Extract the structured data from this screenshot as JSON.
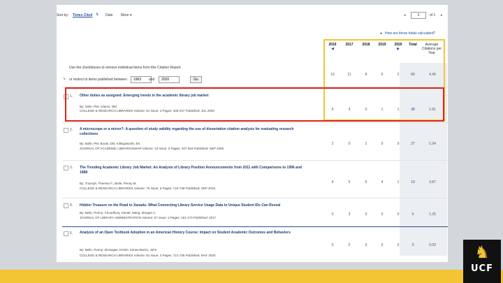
{
  "sort": {
    "label": "Sort by:",
    "active": "Times Cited",
    "options": [
      "Date",
      "More"
    ],
    "page_current": "1",
    "page_total": "of 1"
  },
  "help_link": "How are these totals calculated?",
  "years": [
    "2016",
    "2017",
    "2018",
    "2019",
    "2020",
    "Total",
    "Average Citations per Year"
  ],
  "hint": "Use the checkboxes to remove individual items from this Citation Report",
  "restrict": {
    "label": "or restrict to items published between",
    "from": "1963",
    "and": "and",
    "to": "2020",
    "go": "Go"
  },
  "totals": [
    "19",
    "11",
    "8",
    "5",
    "2",
    "89",
    "4.45"
  ],
  "records": [
    {
      "num": "1.",
      "title": "Other duties as assigned: Emerging trends in the academic library job market",
      "authors": "By: Seile, PM; Adams, NM",
      "source": "COLLEGE & RESEARCH LIBRARIES  Volume: 61  Issue: 4  Pages: 336-347  Published: JUL 2000",
      "cites": [
        "4",
        "4",
        "0",
        "1",
        "1",
        "38",
        "1.81"
      ]
    },
    {
      "num": "2.",
      "title": "A microscope or a mirror?: A question of study validity regarding the use of dissertation citation analysis for evaluating research collections",
      "authors": "By: Bolle, PM; Boote, DN; Killingsworth, EK",
      "source": "JOURNAL OF ACADEMIC LIBRARIANSHIP  Volume: 34  Issue: 5  Pages: 347-353  Published: SEP 2008",
      "cites": [
        "2",
        "0",
        "1",
        "0",
        "0",
        "27",
        "1.94"
      ]
    },
    {
      "num": "3.",
      "title": "The Trending Academic Library Job Market: An Analysis of Library Position Announcements from 2011 with Comparisons to 1996 and 1988",
      "authors": "By: Triumph, Therese F.; Beile, Penny M.",
      "source": "COLLEGE & RESEARCH LIBRARIES  Volume: 76  Issue: 6  Pages: 716-739  Published: SEP 2015",
      "cites": [
        "4",
        "5",
        "6",
        "4",
        "1",
        "19",
        "3.87"
      ]
    },
    {
      "num": "4.",
      "title": "Hidden Treasure on the Road to Xanadu: What Connecting Library Service Usage Data to Unique Student IDs Can Reveal",
      "authors": "By: Beile, Penny; Choudhury, Kanak; Mang, Morgan C.",
      "source": "JOURNAL OF LIBRARY ADMINISTRATION  Volume: 57  Issue: 2  Pages: 151-173  Published: 2017",
      "cites": [
        "0",
        "3",
        "0",
        "0",
        "0",
        "5",
        "1.25"
      ]
    },
    {
      "num": "5.",
      "title": "Analysis of an Open Textbook Adoption in an American History Course: Impact on Student Academic Outcomes and Behaviors",
      "authors": "By: Beile, Penny; deVargas, Kristin; Kimes-Barrio, John",
      "source": "COLLEGE & RESEARCH LIBRARIES  Volume: 81  Issue: 4  Pages: 721-736  Published: MAY 2020",
      "cites": [
        "0",
        "0",
        "0",
        "0",
        "0",
        "0",
        "0.00"
      ]
    }
  ],
  "brand": {
    "name": "UCF",
    "gold": "#f3c433",
    "red": "#e2231a",
    "black": "#111111"
  }
}
